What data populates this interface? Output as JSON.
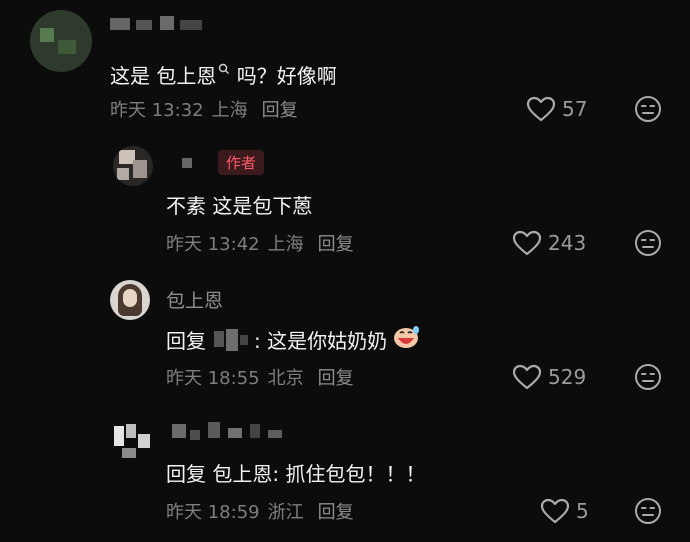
{
  "comments": [
    {
      "text_before": "这是 包上恩",
      "text_after": " 吗？好像啊",
      "time": "昨天 13:32",
      "location": "上海",
      "reply_label": "回复",
      "likes": "57"
    },
    {
      "author_badge": "作者",
      "text": "不素 这是包下蒽",
      "time": "昨天 13:42",
      "location": "上海",
      "reply_label": "回复",
      "likes": "243"
    },
    {
      "name": "包上恩",
      "reply_prefix": "回复",
      "text": ": 这是你姑奶奶",
      "time": "昨天 18:55",
      "location": "北京",
      "reply_label": "回复",
      "likes": "529"
    },
    {
      "text": "回复 包上恩: 抓住包包！！！",
      "time": "昨天 18:59",
      "location": "浙江",
      "reply_label": "回复",
      "likes": "5"
    }
  ],
  "icons": {
    "like": "heart-icon",
    "reaction": "emoji-face-icon",
    "search": "search-icon"
  },
  "colors": {
    "background": "#0c0c0d",
    "author_badge": "#ff5a68"
  }
}
